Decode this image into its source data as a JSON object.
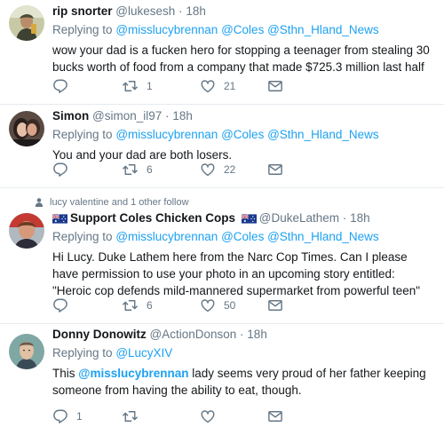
{
  "tweets": [
    {
      "name": "rip snorter",
      "handle": "@lukesesh",
      "separator": "·",
      "time": "18h",
      "reply_prefix": "Replying to",
      "reply_mentions": [
        "@misslucybrennan",
        "@Coles",
        "@Sthn_Hland_News"
      ],
      "text": "wow your dad is a fucken hero for stopping a teenager from stealing 30 bucks worth of food from a company that made $725.3 million last half",
      "counts": {
        "reply": "",
        "retweet": "1",
        "like": "21"
      }
    },
    {
      "name": "Simon",
      "handle": "@simon_il97",
      "separator": "·",
      "time": "18h",
      "reply_prefix": "Replying to",
      "reply_mentions": [
        "@misslucybrennan",
        "@Coles",
        "@Sthn_Hland_News"
      ],
      "text": "You and your dad are both losers.",
      "counts": {
        "reply": "",
        "retweet": "6",
        "like": "22"
      }
    },
    {
      "social_context": "lucy valentine and 1 other follow",
      "name": "Support Coles Chicken Cops",
      "handle": "@DukeLathem",
      "separator": "·",
      "time": "18h",
      "reply_prefix": "Replying to",
      "reply_mentions": [
        "@misslucybrennan",
        "@Coles",
        "@Sthn_Hland_News"
      ],
      "text": "Hi Lucy. Duke Lathem here from the Narc Cop Times. Can I please have permission to use your photo in an upcoming story entitled: \"Heroic cop defends mild-mannered supermarket from powerful teen\"",
      "counts": {
        "reply": "",
        "retweet": "6",
        "like": "50"
      }
    },
    {
      "name": "Donny Donowitz",
      "handle": "@ActionDonson",
      "separator": "·",
      "time": "18h",
      "reply_prefix": "Replying to",
      "reply_mentions": [
        "@LucyXIV"
      ],
      "text_before": "This",
      "text_mention": "@misslucybrennan",
      "text_after": "lady seems very proud of her father keeping someone from having the ability to eat, though.",
      "counts": {
        "reply": "1",
        "retweet": "",
        "like": ""
      }
    }
  ],
  "icons": {
    "reply": "reply-icon",
    "retweet": "retweet-icon",
    "like": "heart-icon",
    "dm": "envelope-icon",
    "follow": "person-icon",
    "flag": "australian-flag-icon"
  },
  "colors": {
    "link": "#1da1f2",
    "muted": "#657786",
    "text": "#14171a",
    "divider": "#e6ecf0"
  }
}
